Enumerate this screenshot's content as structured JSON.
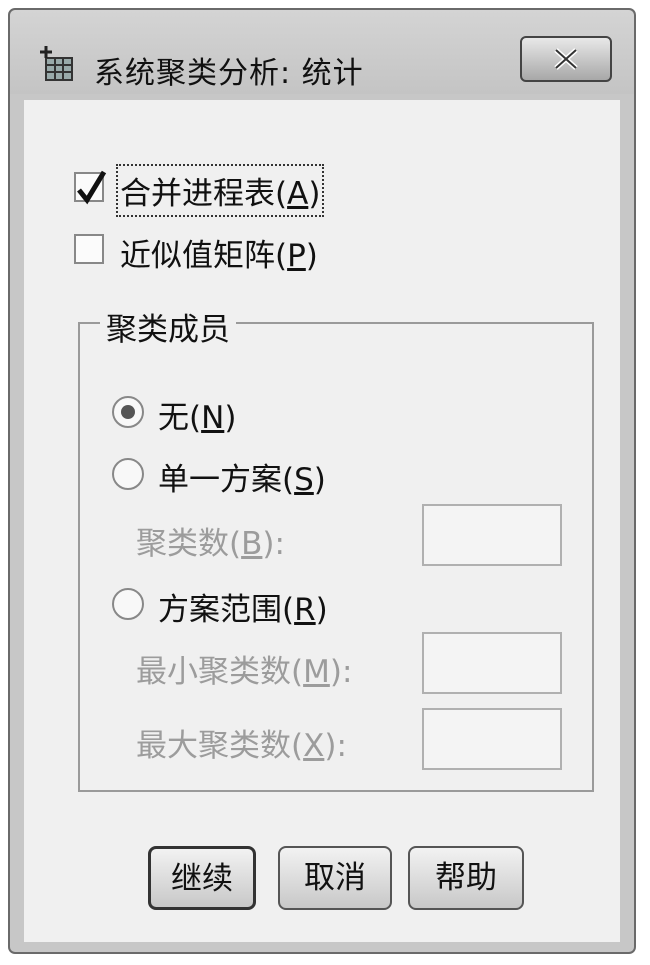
{
  "window": {
    "title": "系统聚类分析: 统计"
  },
  "options": {
    "agglomeration_schedule": {
      "text": "合并进程表(",
      "key": "A",
      "end": ")",
      "checked": true
    },
    "proximity_matrix": {
      "text": "近似值矩阵(",
      "key": "P",
      "end": ")",
      "checked": false
    }
  },
  "cluster_membership": {
    "legend": "聚类成员",
    "none": {
      "text": "无(",
      "key": "N",
      "end": ")",
      "selected": true
    },
    "single_solution": {
      "text": "单一方案(",
      "key": "S",
      "end": ")",
      "selected": false
    },
    "num_clusters_label": {
      "text": "聚类数(",
      "key": "B",
      "end": "):"
    },
    "num_clusters_value": "",
    "range_solutions": {
      "text": "方案范围(",
      "key": "R",
      "end": ")",
      "selected": false
    },
    "min_clusters_label": {
      "text": "最小聚类数(",
      "key": "M",
      "end": "):"
    },
    "min_clusters_value": "",
    "max_clusters_label": {
      "text": "最大聚类数(",
      "key": "X",
      "end": "):"
    },
    "max_clusters_value": ""
  },
  "buttons": {
    "continue": "继续",
    "cancel": "取消",
    "help": "帮助"
  },
  "icons": {
    "app": "spss-table-icon",
    "close": "close-icon",
    "checkmark": "checkmark-icon"
  }
}
